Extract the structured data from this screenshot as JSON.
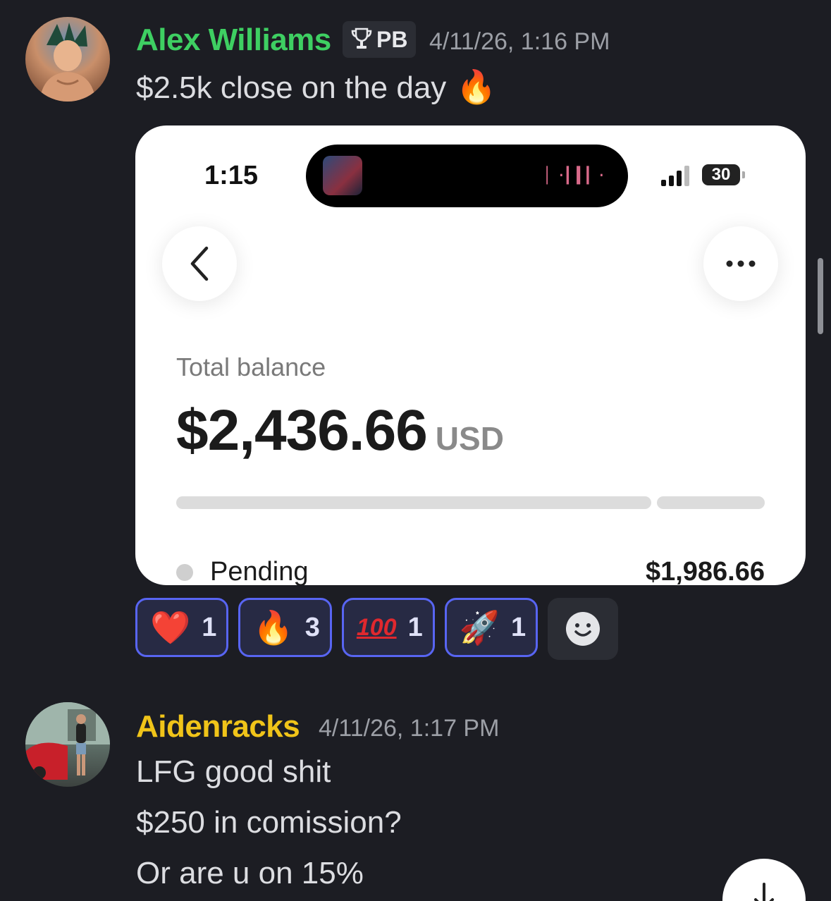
{
  "messages": [
    {
      "author": "Alex Williams",
      "author_color": "#3ecf62",
      "role_badge": {
        "icon": "trophy-icon",
        "label": "PB"
      },
      "timestamp": "4/11/26, 1:16 PM",
      "text": "$2.5k close on the day",
      "text_emoji": "🔥",
      "attachment": {
        "status_bar": {
          "time": "1:15",
          "battery": "30"
        },
        "balance_label": "Total balance",
        "balance_amount": "$2,436.66",
        "balance_currency": "USD",
        "balance_split": {
          "pending_fraction": 0.815
        },
        "pending_label": "Pending",
        "pending_amount": "$1,986.66"
      },
      "reactions": [
        {
          "emoji": "❤️",
          "icon": "heart-emoji",
          "count": "1"
        },
        {
          "emoji": "🔥",
          "icon": "fire-emoji",
          "count": "3"
        },
        {
          "emoji": "100",
          "icon": "hundred-points-emoji",
          "count": "1"
        },
        {
          "emoji": "🚀",
          "icon": "rocket-emoji",
          "count": "1"
        }
      ]
    },
    {
      "author": "Aidenracks",
      "author_color": "#f0c419",
      "timestamp": "4/11/26, 1:17 PM",
      "lines": [
        "LFG good shit",
        "$250 in comission?",
        "Or are u on 15%"
      ]
    }
  ],
  "colors": {
    "background": "#1c1d23",
    "reaction_border": "#5865f2"
  }
}
